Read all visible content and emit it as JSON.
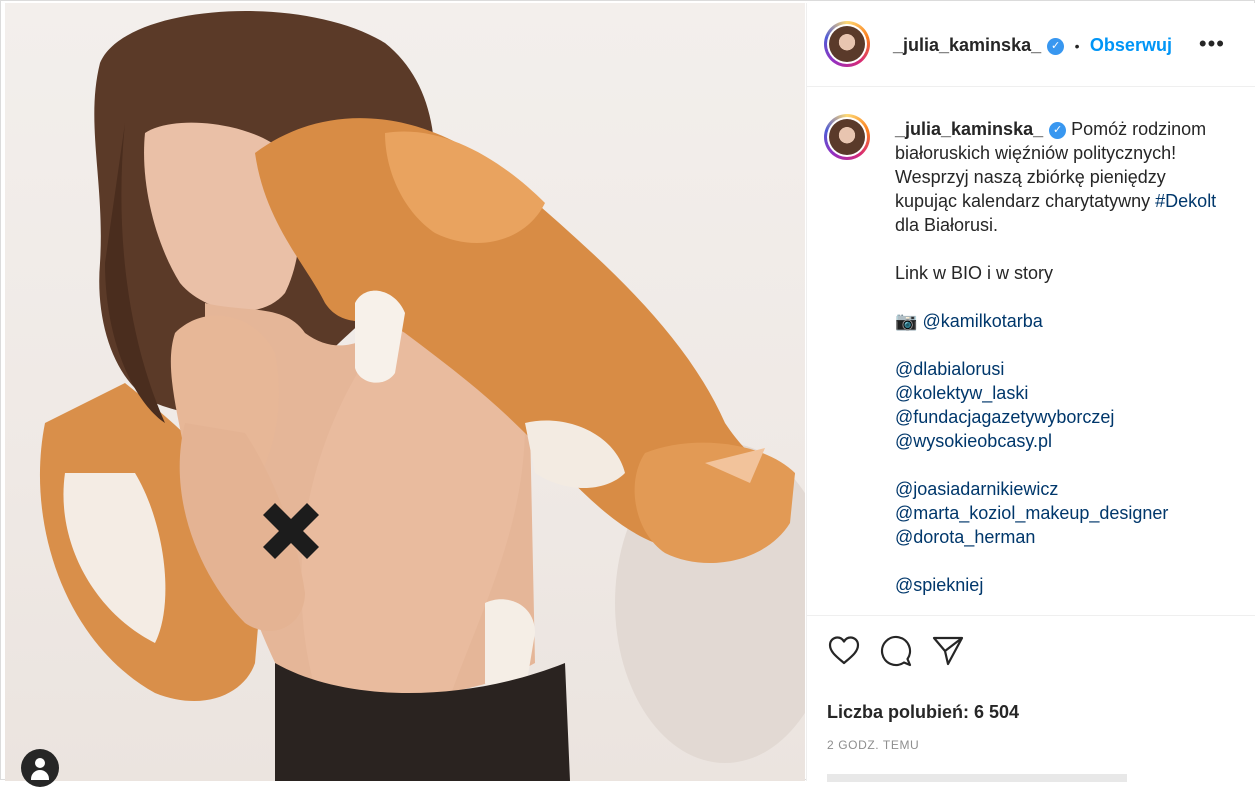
{
  "post": {
    "username": "_julia_kaminska_",
    "separator": "•",
    "follow_label": "Obserwuj",
    "more_label": "•••"
  },
  "caption": {
    "username": "_julia_kaminska_",
    "line1_text": "Pomóż rodzinom",
    "line2": "białoruskich więźniów politycznych!",
    "line3": "Wesprzyj naszą zbiórkę pieniędzy",
    "line4_text": "kupując kalendarz charytatywny",
    "line4_hashtag": "#Dekolt",
    "line5": "dla Białorusi.",
    "link_line": "Link w BIO i w story",
    "camera_emoji": "📷",
    "photographer": "@kamilkotarba",
    "mentions_group1": [
      "@dlabialorusi",
      "@kolektyw_laski",
      "@fundacjagazetywyborczej",
      "@wysokieobcasy.pl"
    ],
    "mentions_group2": [
      "@joasiadarnikiewicz",
      "@marta_koziol_makeup_designer",
      "@dorota_herman"
    ],
    "mentions_group3": [
      "@spiekniej"
    ]
  },
  "stats": {
    "likes": "Liczba polubień: 6 504",
    "time": "2 GODZ. TEMU"
  },
  "icons": {
    "like": "heart-icon",
    "comment": "comment-bubble-icon",
    "share": "paper-plane-icon",
    "verified": "verified-badge-icon",
    "tagged_user": "user-icon"
  },
  "colors": {
    "link": "#00376b",
    "follow": "#0095f6",
    "verified": "#3897f0",
    "text": "#262626",
    "muted": "#8e8e8e"
  }
}
